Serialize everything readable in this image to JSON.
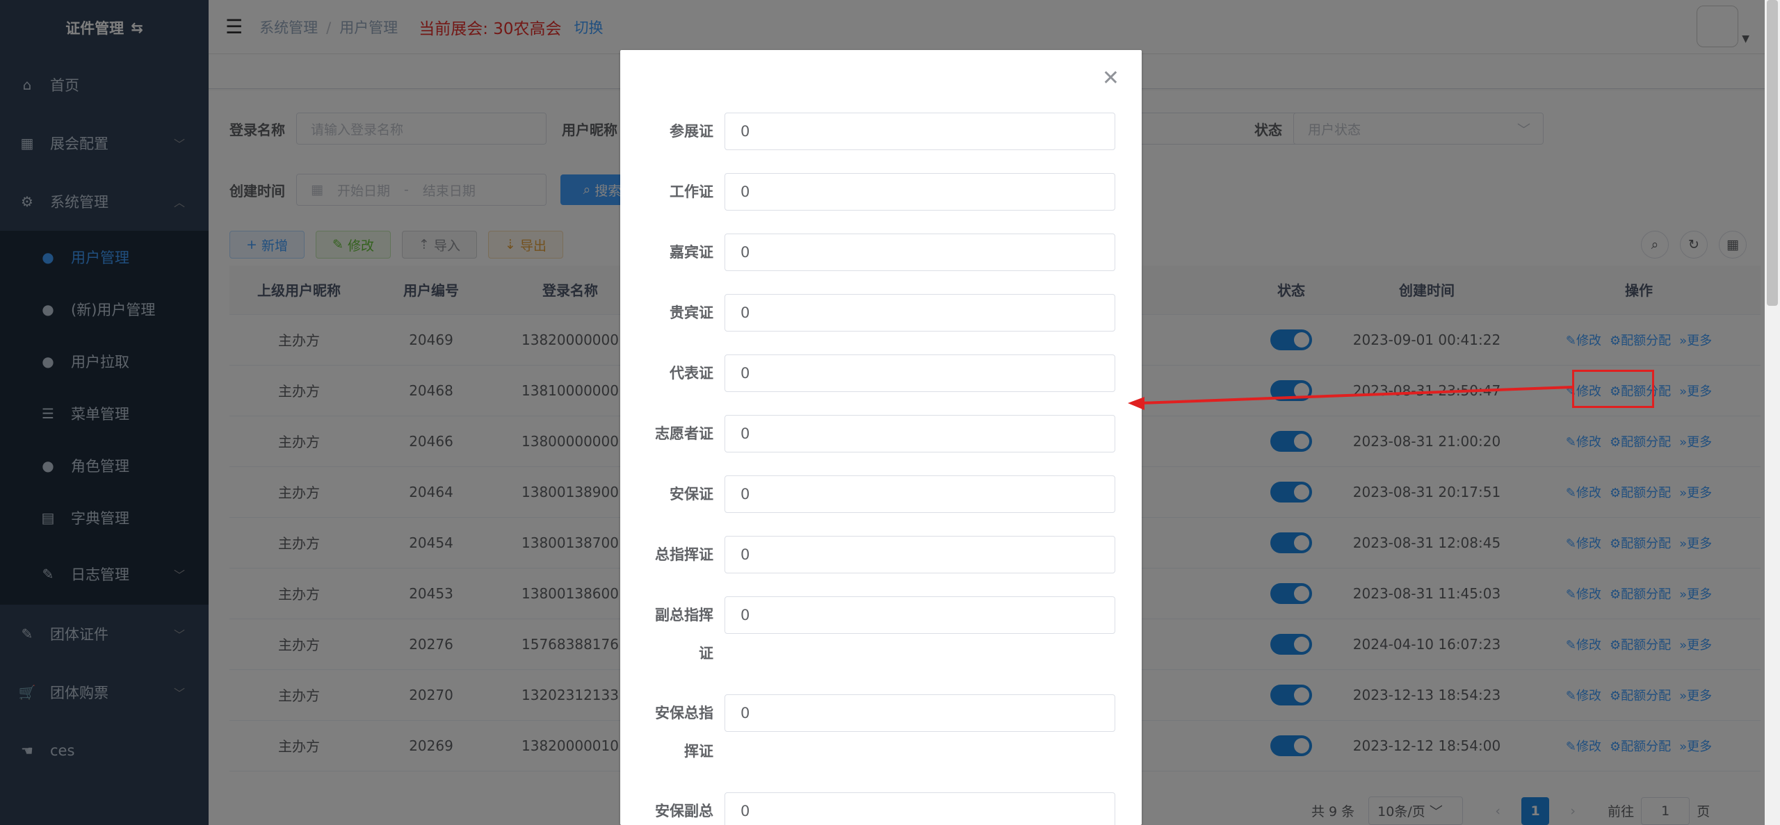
{
  "sidebar": {
    "logo": "证件管理",
    "items": [
      {
        "label": "首页",
        "icon": "home-icon"
      },
      {
        "label": "展会配置",
        "icon": "calendar-icon"
      },
      {
        "label": "系统管理",
        "icon": "gear-icon"
      }
    ],
    "system_sub": [
      {
        "label": "用户管理",
        "icon": "user-icon"
      },
      {
        "label": "(新)用户管理",
        "icon": "user-icon"
      },
      {
        "label": "用户拉取",
        "icon": "users-icon"
      },
      {
        "label": "菜单管理",
        "icon": "tree-icon"
      },
      {
        "label": "角色管理",
        "icon": "users-icon"
      },
      {
        "label": "字典管理",
        "icon": "dict-icon"
      },
      {
        "label": "日志管理",
        "icon": "log-icon"
      }
    ],
    "bottom_items": [
      {
        "label": "团体证件",
        "icon": "edit-icon"
      },
      {
        "label": "团体购票",
        "icon": "cart-icon"
      },
      {
        "label": "ces",
        "icon": "hand-icon"
      }
    ]
  },
  "navbar": {
    "breadcrumb": [
      "系统管理",
      "用户管理"
    ],
    "exhibit_label": "当前展会:",
    "exhibit_name": "30农高会",
    "switch_label": "切换"
  },
  "filters": {
    "login_label": "登录名称",
    "login_placeholder": "请输入登录名称",
    "nick_label": "用户昵称",
    "status_label": "状态",
    "status_placeholder": "用户状态",
    "created_label": "创建时间",
    "start_placeholder": "开始日期",
    "range_sep": "-",
    "end_placeholder": "结束日期",
    "search_label": "搜索"
  },
  "toolbar": {
    "add": "新增",
    "edit": "修改",
    "import": "导入",
    "export": "导出"
  },
  "table": {
    "headers": [
      "上级用户昵称",
      "用户编号",
      "登录名称",
      "状态",
      "创建时间",
      "操作"
    ],
    "rows": [
      {
        "parent": "主办方",
        "id": "20469",
        "login": "13820000000",
        "created": "2023-09-01 00:41:22"
      },
      {
        "parent": "主办方",
        "id": "20468",
        "login": "13810000000",
        "created": "2023-08-31 23:50:47"
      },
      {
        "parent": "主办方",
        "id": "20466",
        "login": "13800000000",
        "created": "2023-08-31 21:00:20"
      },
      {
        "parent": "主办方",
        "id": "20464",
        "login": "13800138900",
        "created": "2023-08-31 20:17:51"
      },
      {
        "parent": "主办方",
        "id": "20454",
        "login": "13800138700",
        "created": "2023-08-31 12:08:45"
      },
      {
        "parent": "主办方",
        "id": "20453",
        "login": "13800138600",
        "created": "2023-08-31 11:45:03"
      },
      {
        "parent": "主办方",
        "id": "20276",
        "login": "15768388176",
        "created": "2024-04-10 16:07:23"
      },
      {
        "parent": "主办方",
        "id": "20270",
        "login": "13202312133",
        "created": "2023-12-13 18:54:23"
      },
      {
        "parent": "主办方",
        "id": "20269",
        "login": "13820000010",
        "created": "2023-12-12 18:54:00"
      }
    ],
    "ops": {
      "edit": "修改",
      "quota": "配额分配",
      "more": "更多"
    }
  },
  "pagination": {
    "total": "共 9 条",
    "page_size": "10条/页",
    "current": "1",
    "goto_label": "前往",
    "goto_value": "1",
    "page_suffix": "页"
  },
  "dialog": {
    "fields": [
      {
        "label": "参展证",
        "value": "0"
      },
      {
        "label": "工作证",
        "value": "0"
      },
      {
        "label": "嘉宾证",
        "value": "0"
      },
      {
        "label": "贵宾证",
        "value": "0"
      },
      {
        "label": "代表证",
        "value": "0"
      },
      {
        "label": "志愿者证",
        "value": "0"
      },
      {
        "label": "安保证",
        "value": "0"
      },
      {
        "label": "总指挥证",
        "value": "0"
      },
      {
        "label": "副总指挥证",
        "value": "0"
      },
      {
        "label": "安保总指挥证",
        "value": "0"
      },
      {
        "label": "安保副总",
        "value": "0"
      }
    ]
  },
  "colors": {
    "sidebar_bg": "#304156",
    "accent": "#409eff",
    "exhibit": "#e6312c",
    "annotation": "#e02020"
  }
}
